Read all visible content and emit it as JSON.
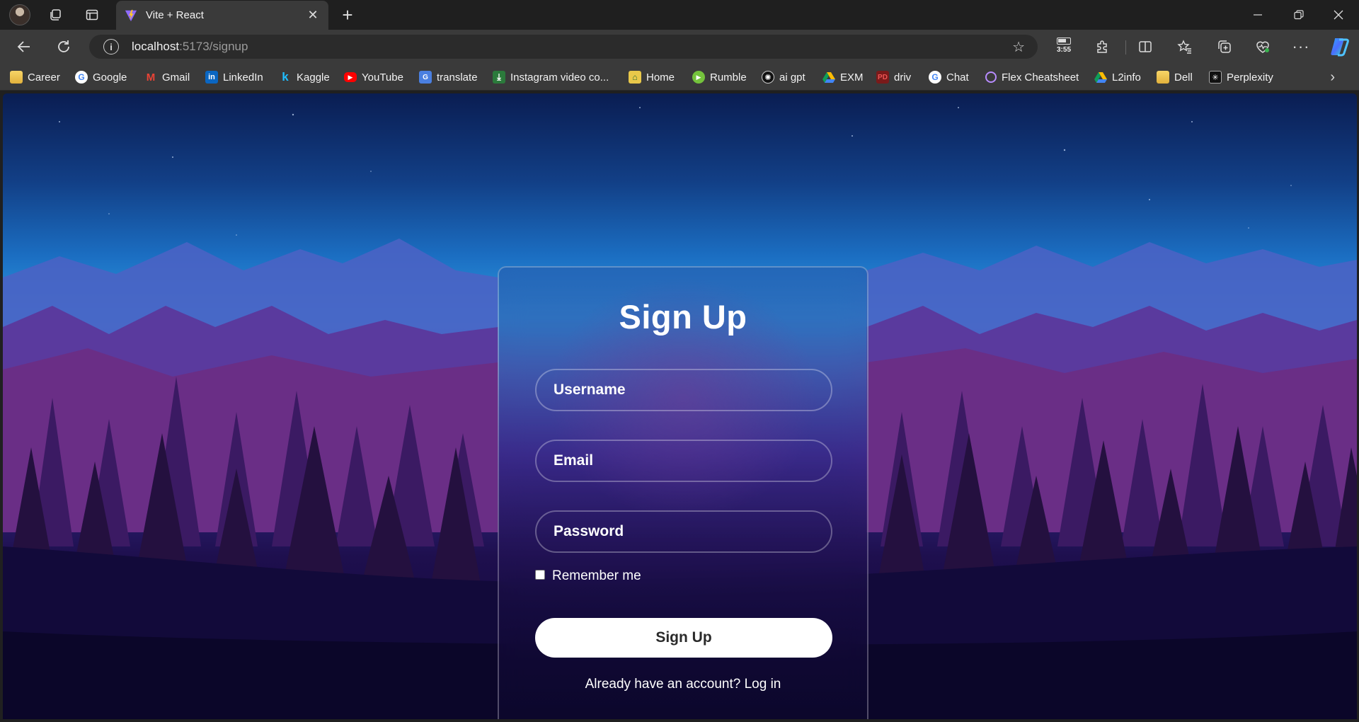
{
  "browser": {
    "tab_title": "Vite + React",
    "url_host": "localhost",
    "url_path": ":5173/signup",
    "battery_time": "3:55"
  },
  "bookmarks": [
    {
      "label": "Career",
      "icon": "folder-icon"
    },
    {
      "label": "Google",
      "icon": "google-icon"
    },
    {
      "label": "Gmail",
      "icon": "gmail-icon"
    },
    {
      "label": "LinkedIn",
      "icon": "linkedin-icon"
    },
    {
      "label": "Kaggle",
      "icon": "kaggle-icon"
    },
    {
      "label": "YouTube",
      "icon": "youtube-icon"
    },
    {
      "label": "translate",
      "icon": "translate-icon"
    },
    {
      "label": "Instagram video co...",
      "icon": "instagram-downloader-icon"
    },
    {
      "label": "Home",
      "icon": "home-icon"
    },
    {
      "label": "Rumble",
      "icon": "rumble-icon"
    },
    {
      "label": "ai gpt",
      "icon": "openai-icon"
    },
    {
      "label": "EXM",
      "icon": "google-drive-icon"
    },
    {
      "label": "driv",
      "icon": "driv-icon"
    },
    {
      "label": "Chat",
      "icon": "google-icon"
    },
    {
      "label": "Flex Cheatsheet",
      "icon": "ring-icon"
    },
    {
      "label": "L2info",
      "icon": "google-drive-icon"
    },
    {
      "label": "Dell",
      "icon": "folder-icon"
    },
    {
      "label": "Perplexity",
      "icon": "perplexity-icon"
    }
  ],
  "signup": {
    "title": "Sign Up",
    "username_placeholder": "Username",
    "email_placeholder": "Email",
    "password_placeholder": "Password",
    "remember_label": "Remember me",
    "submit_label": "Sign Up",
    "login_prompt": "Already have an account? Log in"
  },
  "colors": {
    "accent": "#ffffff",
    "sky_top": "#0a1d52",
    "horizon": "#2f9be0",
    "forest": "#2a1453"
  }
}
